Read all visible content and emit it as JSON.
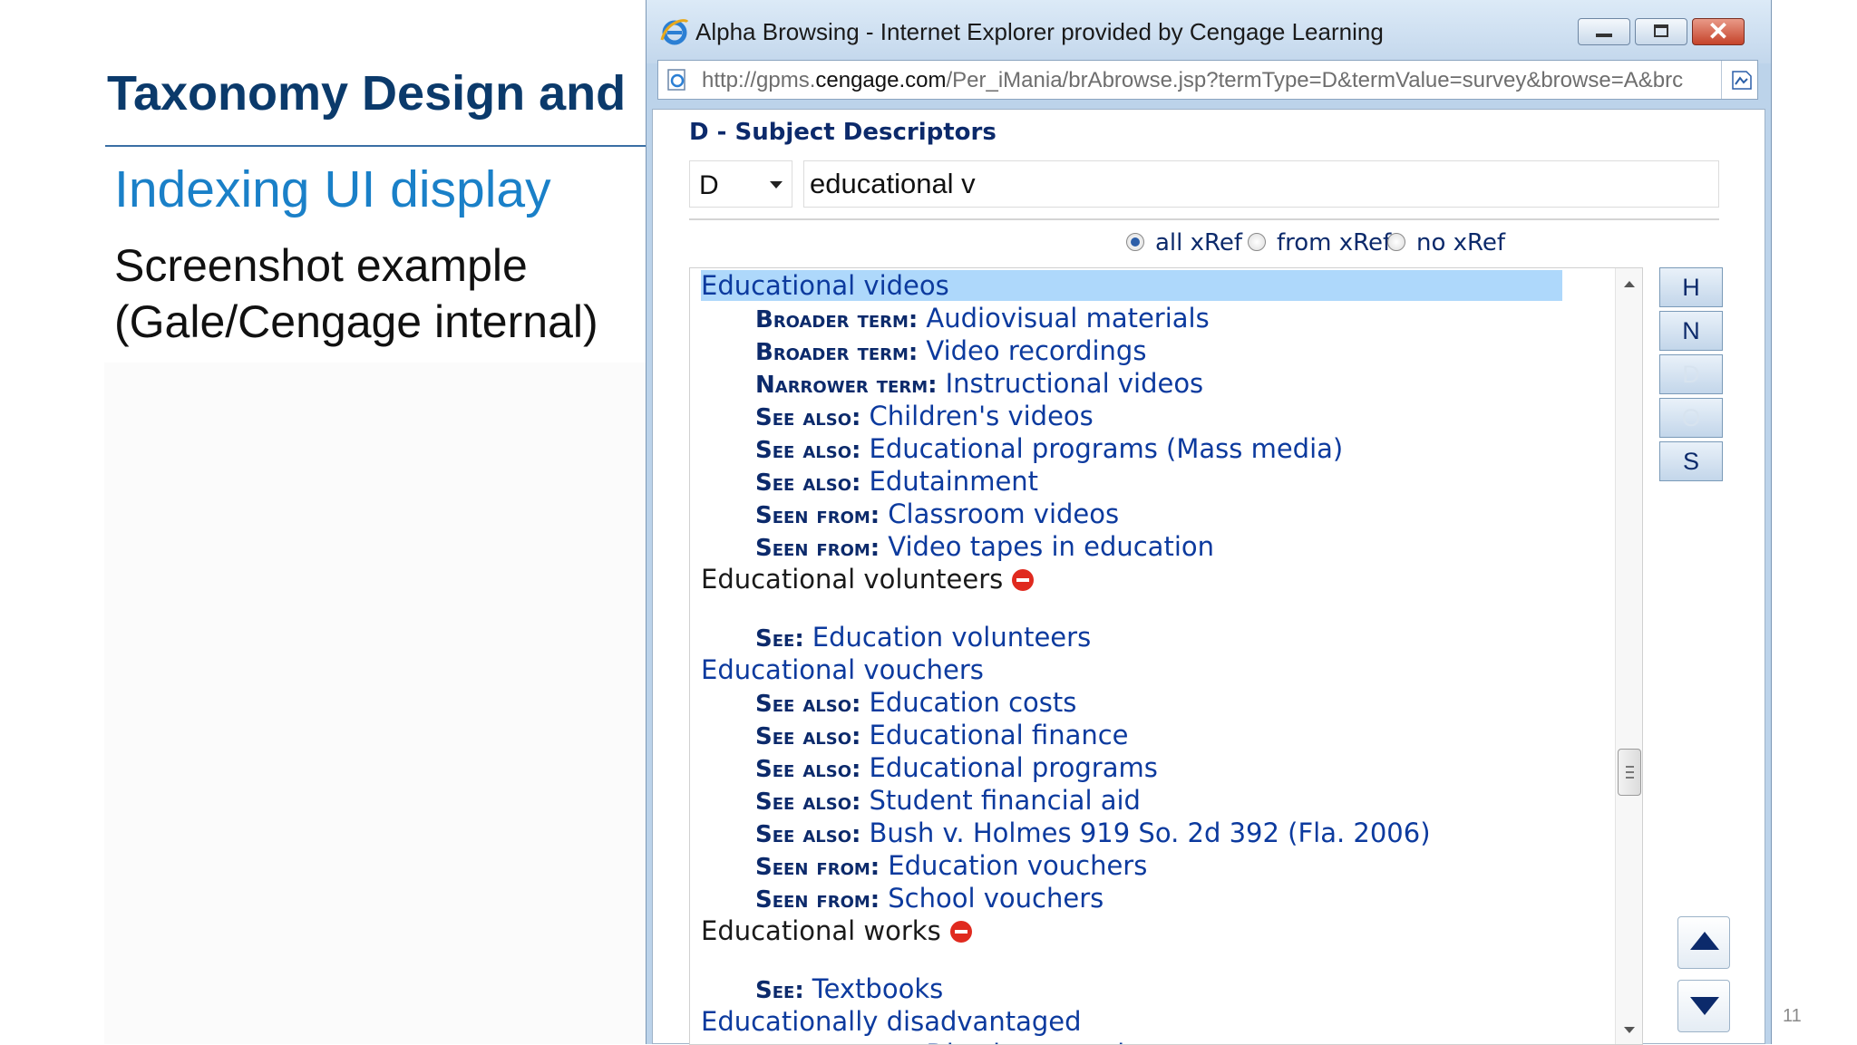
{
  "slide": {
    "title": "Taxonomy Design and",
    "subtitle": "Indexing UI display",
    "body_line1": "Screenshot example",
    "body_line2": "(Gale/Cengage internal)",
    "page_number": "11"
  },
  "window": {
    "title": "Alpha Browsing - Internet Explorer provided by Cengage Learning",
    "url_prefix": "http://gpms.",
    "url_domain": "cengage.com",
    "url_path": "/Per_iMania/brAbrowse.jsp?termType=D&termValue=survey&browse=A&brc"
  },
  "panel": {
    "heading": "D - Subject Descriptors",
    "type_select": "D",
    "search_value": "educational v",
    "xref_options": [
      {
        "label": "all xRef",
        "selected": true
      },
      {
        "label": "from xRef",
        "selected": false
      },
      {
        "label": "no xRef",
        "selected": false
      }
    ]
  },
  "entries": [
    {
      "term": "Educational videos",
      "selected": true,
      "relations": [
        {
          "label": "Broader term:",
          "value": "Audiovisual materials"
        },
        {
          "label": "Broader term:",
          "value": "Video recordings"
        },
        {
          "label": "Narrower term:",
          "value": "Instructional videos"
        },
        {
          "label": "See also:",
          "value": "Children's videos"
        },
        {
          "label": "See also:",
          "value": "Educational programs (Mass media)"
        },
        {
          "label": "See also:",
          "value": "Edutainment"
        },
        {
          "label": "Seen from:",
          "value": "Classroom videos"
        },
        {
          "label": "Seen from:",
          "value": "Video tapes in education"
        }
      ]
    },
    {
      "term": "Educational volunteers",
      "nonpreferred": true,
      "relations": [
        {
          "label": "See:",
          "value": "Education volunteers"
        }
      ]
    },
    {
      "term": "Educational vouchers",
      "relations": [
        {
          "label": "See also:",
          "value": "Education costs"
        },
        {
          "label": "See also:",
          "value": "Educational finance"
        },
        {
          "label": "See also:",
          "value": "Educational programs"
        },
        {
          "label": "See also:",
          "value": "Student financial aid"
        },
        {
          "label": "See also:",
          "value": "Bush v. Holmes 919 So. 2d 392 (Fla. 2006)"
        },
        {
          "label": "Seen from:",
          "value": "Education vouchers"
        },
        {
          "label": "Seen from:",
          "value": "School vouchers"
        }
      ]
    },
    {
      "term": "Educational works",
      "nonpreferred": true,
      "relations": [
        {
          "label": "See:",
          "value": "Textbooks"
        }
      ]
    },
    {
      "term": "Educationally disadvantaged",
      "relations": [
        {
          "label": "Broader term:",
          "value": "Disadvantaged persons"
        }
      ]
    }
  ],
  "letter_rail": [
    {
      "label": "H",
      "enabled": true
    },
    {
      "label": "N",
      "enabled": true
    },
    {
      "label": "D",
      "enabled": false
    },
    {
      "label": "O",
      "enabled": false
    },
    {
      "label": "S",
      "enabled": true
    }
  ],
  "icons": {
    "browser": "ie-logo-icon",
    "page": "page-icon",
    "compatibility": "compatibility-view-icon",
    "nonpreferred_marker": "no-entry-icon",
    "scroll_up": "arrow-up-icon",
    "scroll_down": "arrow-down-icon"
  },
  "colors": {
    "slide_title": "#0b3a6b",
    "slide_subtitle": "#1a80c8",
    "term_link": "#0c3a9e",
    "selection": "#aed8fb",
    "nonpreferred_marker": "#e02a1f"
  }
}
